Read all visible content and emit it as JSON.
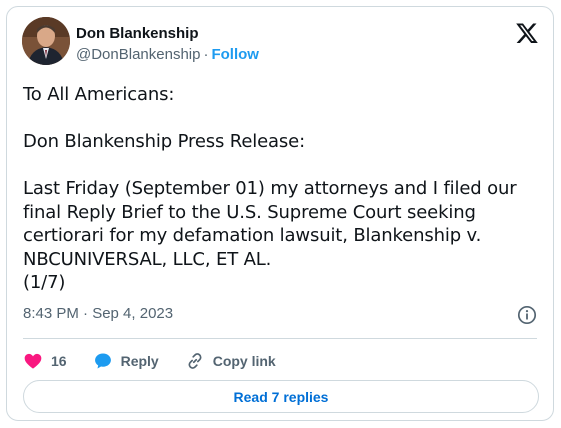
{
  "author": {
    "name": "Don Blankenship",
    "handle": "@DonBlankenship",
    "separator": "·",
    "follow_label": "Follow"
  },
  "tweet": {
    "lines": [
      "To All Americans:",
      "",
      "Don Blankenship Press Release:",
      "",
      "Last Friday (September 01) my attorneys and I filed our\nfinal Reply Brief to the U.S. Supreme Court seeking\ncertiorari for my defamation lawsuit, Blankenship v.\nNBCUNIVERSAL, LLC, ET AL.\n(1/7)"
    ],
    "timestamp": "8:43 PM · Sep 4, 2023"
  },
  "actions": {
    "like_count": "16",
    "reply_label": "Reply",
    "copy_link_label": "Copy link"
  },
  "footer": {
    "read_replies_label": "Read 7 replies"
  },
  "colors": {
    "accent": "#1d9bf0",
    "like": "#f91880",
    "muted": "#536471",
    "border": "#cfd9de"
  },
  "icons": [
    "x-logo-icon",
    "info-icon",
    "heart-icon",
    "reply-icon",
    "link-icon"
  ]
}
